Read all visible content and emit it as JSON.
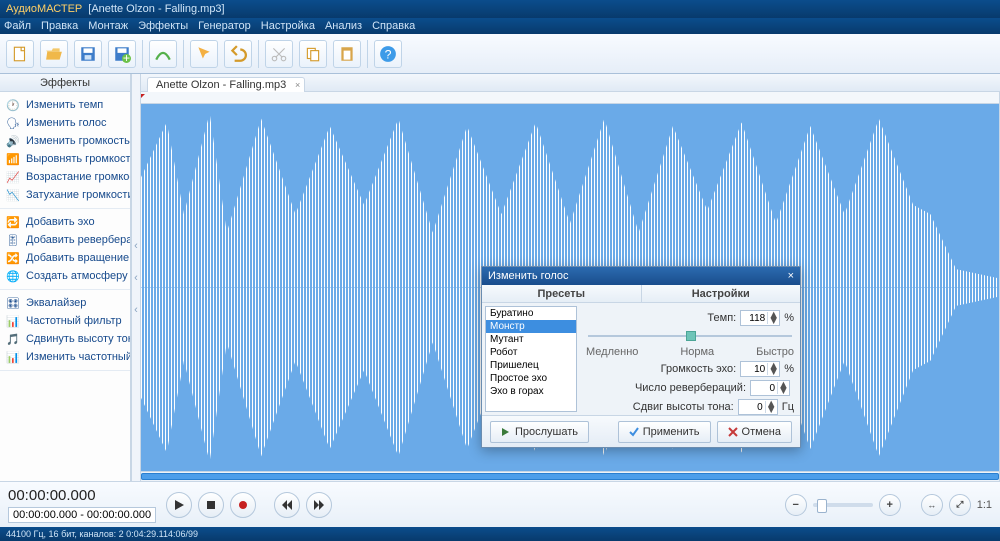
{
  "title": {
    "app": "АудиоМАСТЕР",
    "file": "[Anette Olzon - Falling.mp3]"
  },
  "menu": [
    "Файл",
    "Правка",
    "Монтаж",
    "Эффекты",
    "Генератор",
    "Настройка",
    "Анализ",
    "Справка"
  ],
  "sidebar": {
    "header": "Эффекты",
    "groups": [
      [
        "Изменить темп",
        "Изменить голос",
        "Изменить громкость",
        "Выровнять громкость",
        "Возрастание громкости",
        "Затухание громкости"
      ],
      [
        "Добавить эхо",
        "Добавить реверберацию",
        "Добавить вращение каналов",
        "Создать атмосферу"
      ],
      [
        "Эквалайзер",
        "Частотный фильтр",
        "Сдвинуть высоту тона",
        "Изменить частотный спектр"
      ]
    ]
  },
  "tab": {
    "label": "Anette Olzon - Falling.mp3"
  },
  "time": {
    "big": "00:00:00.000",
    "from": "00:00:00.000",
    "to": "00:00:00.000",
    "sep": "-"
  },
  "zoom": {
    "ratio": "1:1"
  },
  "status": "44100 Гц, 16 бит, каналов: 2   0:04:29.114:06/99",
  "dialog": {
    "title": "Изменить голос",
    "col1": "Пресеты",
    "col2": "Настройки",
    "presets": [
      "Буратино",
      "Монстр",
      "Мутант",
      "Робот",
      "Пришелец",
      "Простое эхо",
      "Эхо в горах"
    ],
    "sel": 1,
    "tempo": {
      "label": "Темп:",
      "val": "118",
      "unit": "%"
    },
    "sliderL": "Медленно",
    "sliderM": "Норма",
    "sliderR": "Быстро",
    "echo": {
      "label": "Громкость эхо:",
      "val": "10",
      "unit": "%"
    },
    "reverb": {
      "label": "Число ревербераций:",
      "val": "0",
      "unit": ""
    },
    "pitch": {
      "label": "Сдвиг высоты тона:",
      "val": "0",
      "unit": "Гц"
    },
    "listen": "Прослушать",
    "apply": "Применить",
    "cancel": "Отмена"
  }
}
